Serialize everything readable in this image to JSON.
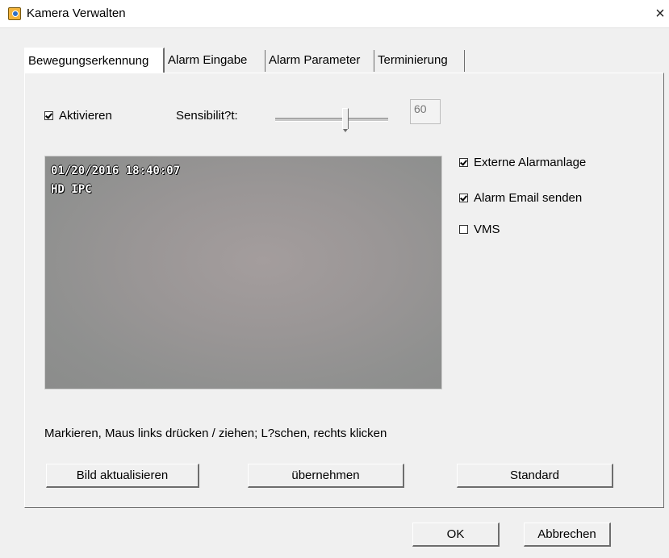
{
  "window": {
    "title": "Kamera Verwalten",
    "close_glyph": "×"
  },
  "tabs": [
    {
      "label": "Bewegungserkennung",
      "active": true
    },
    {
      "label": "Alarm Eingabe",
      "active": false
    },
    {
      "label": "Alarm Parameter",
      "active": false
    },
    {
      "label": "Terminierung",
      "active": false
    }
  ],
  "motion": {
    "enable_label": "Aktivieren",
    "enable_checked": true,
    "sensitivity_label": "Sensibilit?t:",
    "sensitivity_value": "60"
  },
  "video": {
    "timestamp": "01/20/2016 18:40:07",
    "camera_label": "HD IPC"
  },
  "options": [
    {
      "label": "Externe Alarmanlage",
      "checked": true
    },
    {
      "label": "Alarm Email senden",
      "checked": true
    },
    {
      "label": "VMS",
      "checked": false
    }
  ],
  "hint": "Markieren, Maus links drücken / ziehen; L?schen, rechts klicken",
  "buttons": {
    "refresh": "Bild aktualisieren",
    "apply": "übernehmen",
    "default": "Standard",
    "ok": "OK",
    "cancel": "Abbrechen"
  }
}
